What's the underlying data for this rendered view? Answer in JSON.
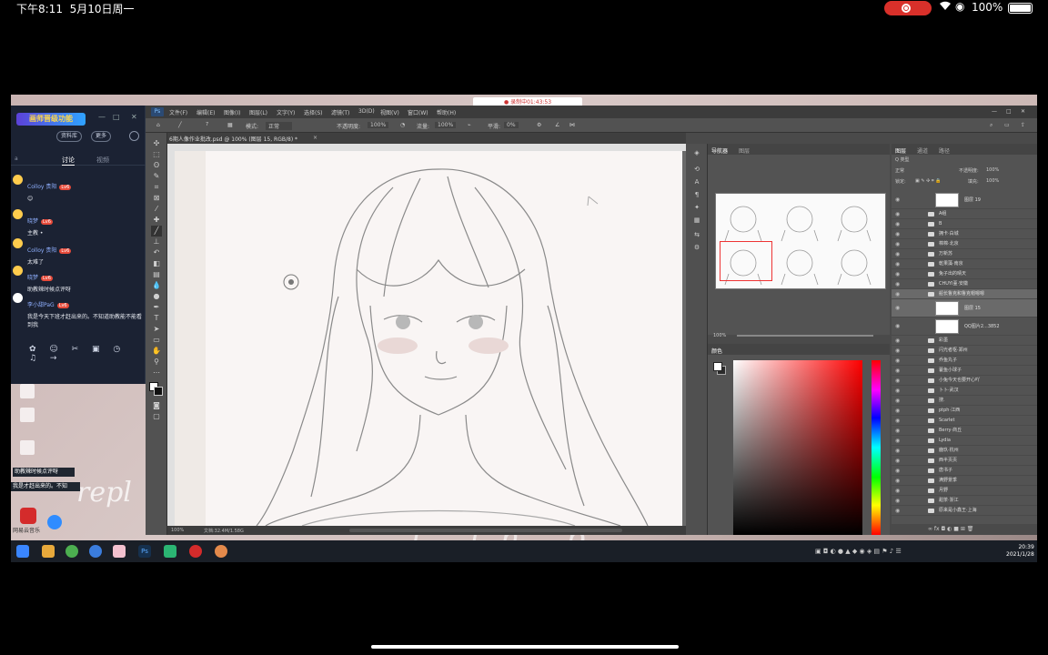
{
  "status_bar": {
    "time": "下午8:11",
    "date": "5月10日周一",
    "battery": "100%",
    "wifi_icon": "wifi-icon",
    "location_icon": "location-icon",
    "record_icon": "screen-record-icon"
  },
  "recording_label": "● 录制中01:43:53",
  "chat": {
    "title": "画师晋级功能",
    "buttons": [
      "资料库",
      "更多"
    ],
    "side_label": "a",
    "tabs": [
      "讨论",
      "视频"
    ],
    "messages": [
      {
        "name": "Colloy 贵阳",
        "level": "Lv6",
        "text": "😊"
      },
      {
        "name": "晓梦",
        "level": "Lv6",
        "text": "主教 •"
      },
      {
        "name": "Colloy 贵阳",
        "level": "Lv6",
        "text": "太难了"
      },
      {
        "name": "晓梦",
        "level": "Lv6",
        "text": "助教辣时候点评呀"
      },
      {
        "name": "李小甜PaG",
        "level": "Lv6",
        "text": "我是今天下班才赶出来的。不知道助教能不能看到我"
      }
    ],
    "emoji_bar": "✿ ☺ ✂ ▣ ◷ ♫ →"
  },
  "desktop": {
    "notification1": "助教辣时候点评呀",
    "notification2": "我是才赶出来的。不知",
    "icon_label": "网易云音乐",
    "cursive": "repl",
    "cursive2": "t th b"
  },
  "ps": {
    "menus": [
      "文件(F)",
      "编辑(E)",
      "图像(I)",
      "图层(L)",
      "文字(Y)",
      "选择(S)",
      "滤镜(T)",
      "3D(D)",
      "视图(V)",
      "窗口(W)",
      "帮助(H)"
    ],
    "logo": "Ps",
    "options": {
      "mode_label": "模式:",
      "mode": "正常",
      "opacity_label": "不透明度:",
      "opacity": "100%",
      "flow_label": "流量:",
      "flow": "100%",
      "smooth_label": "平滑:",
      "smooth": "0%",
      "brush_size": "7"
    },
    "doc_tab": "6期人像作业批改.psd @ 100% (图层 15, RGB/8) *",
    "zoom": "100%",
    "doc_size": "文档:32.4M/1.58G",
    "nav_tabs": [
      "导航器",
      "图层"
    ],
    "nav_zoom": "100%",
    "color_tab": "颜色",
    "layer_tabs": [
      "图层",
      "通道",
      "路径"
    ],
    "layer_filter": "Q 类型",
    "blend": "正常",
    "opacity_label": "不透明度:",
    "opacity": "100%",
    "lock_label": "锁定:",
    "fill_label": "填充:",
    "fill": "100%",
    "layers": [
      {
        "name": "图层 19",
        "thumb": true
      },
      {
        "name": "A组",
        "folder": true
      },
      {
        "name": "B",
        "folder": true
      },
      {
        "name": "拥卡·白城",
        "folder": true
      },
      {
        "name": "棉棉·北京",
        "folder": true
      },
      {
        "name": "万新苏",
        "folder": true
      },
      {
        "name": "乾果藻·南京",
        "folder": true
      },
      {
        "name": "兔子出的晴天",
        "folder": true
      },
      {
        "name": "CHUYI堇·安徽",
        "folder": true
      },
      {
        "name": "船长鲁克和鲁克帽嗯嗯",
        "folder": true,
        "sel": true
      },
      {
        "name": "图层 15",
        "thumb": true,
        "sel": true
      },
      {
        "name": "QQ图片2...3852",
        "thumb": true
      },
      {
        "name": "彩墨",
        "folder": true
      },
      {
        "name": "闪光者枢·郑州",
        "folder": true
      },
      {
        "name": "乔鱼丸子",
        "folder": true
      },
      {
        "name": "藿鱼小球子",
        "folder": true
      },
      {
        "name": "小兔今天也要开心吖",
        "folder": true
      },
      {
        "name": "卜卜·武汉",
        "folder": true
      },
      {
        "name": "搜.",
        "folder": true
      },
      {
        "name": "ptph·江西",
        "folder": true
      },
      {
        "name": "Scarlet",
        "folder": true
      },
      {
        "name": "Berry·商丘",
        "folder": true
      },
      {
        "name": "Lydia",
        "folder": true
      },
      {
        "name": "鹿玖·杭州",
        "folder": true
      },
      {
        "name": "西半页页",
        "folder": true
      },
      {
        "name": "唐书子",
        "folder": true
      },
      {
        "name": "满野景季",
        "folder": true
      },
      {
        "name": "月野",
        "folder": true
      },
      {
        "name": "甜茶·浙江",
        "folder": true
      },
      {
        "name": "原来是小鑫王·上海",
        "folder": true
      }
    ],
    "layer_bottom": "∞ fx ◘ ◐ ■ ⊞ 🗑"
  },
  "taskbar": {
    "time": "20:39",
    "date": "2021/1/28"
  },
  "colors": {
    "ps_bg": "#4a4a4a",
    "panel": "#535353",
    "chat_bg": "#1b2233",
    "record": "#d9302a"
  }
}
